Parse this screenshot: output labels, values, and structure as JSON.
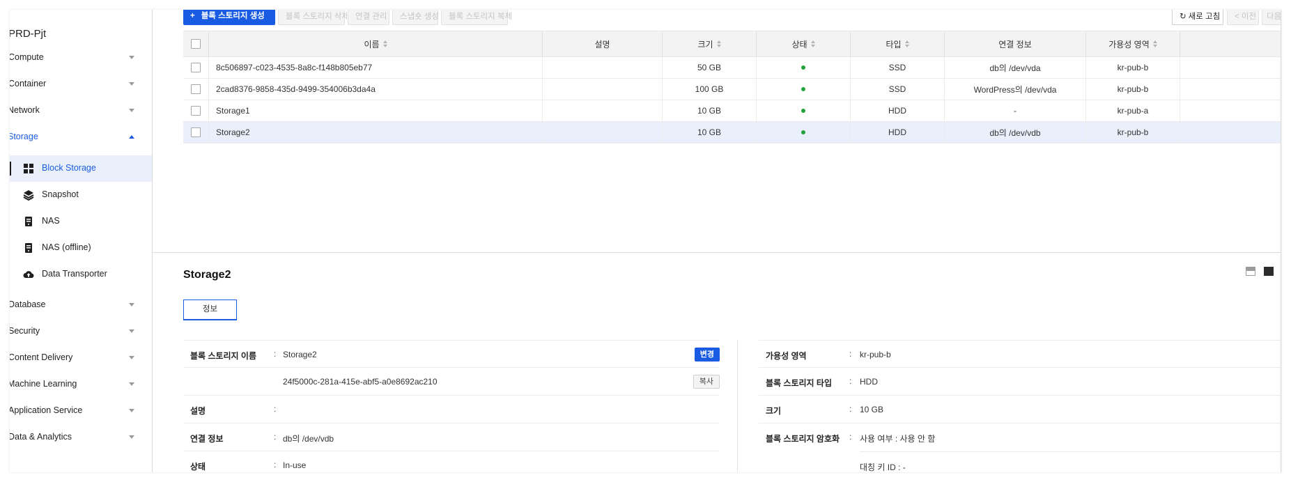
{
  "sidebar": {
    "project": "PRD-Pjt",
    "menus": [
      {
        "label": "Compute"
      },
      {
        "label": "Container"
      },
      {
        "label": "Network"
      },
      {
        "label": "Storage"
      },
      {
        "label": "Database"
      },
      {
        "label": "Security"
      },
      {
        "label": "Content Delivery"
      },
      {
        "label": "Machine Learning"
      },
      {
        "label": "Application Service"
      },
      {
        "label": "Data & Analytics"
      }
    ],
    "storage_items": [
      {
        "label": "Block Storage",
        "icon": "grid-icon"
      },
      {
        "label": "Snapshot",
        "icon": "layers-icon"
      },
      {
        "label": "NAS",
        "icon": "server-icon"
      },
      {
        "label": "NAS (offline)",
        "icon": "server-icon"
      },
      {
        "label": "Data Transporter",
        "icon": "cloud-upload-icon"
      }
    ]
  },
  "toolbar": {
    "create": "블록 스토리지 생성",
    "delete": "블록 스토리지 삭제",
    "connect": "연결 관리",
    "snapshot": "스냅숏 생성",
    "clone": "블록 스토리지 복제",
    "refresh": "새로 고침",
    "prev": "< 이전",
    "next": "다음"
  },
  "table": {
    "columns": [
      "이름",
      "설명",
      "크기",
      "상태",
      "타입",
      "연결 정보",
      "가용성 영역"
    ],
    "rows": [
      {
        "name": "8c506897-c023-4535-8a8c-f148b805eb77",
        "desc": "",
        "size": "50 GB",
        "type": "SSD",
        "conn": "db의 /dev/vda",
        "zone": "kr-pub-b"
      },
      {
        "name": "2cad8376-9858-435d-9499-354006b3da4a",
        "desc": "",
        "size": "100 GB",
        "type": "SSD",
        "conn": "WordPress의 /dev/vda",
        "zone": "kr-pub-b"
      },
      {
        "name": "Storage1",
        "desc": "",
        "size": "10 GB",
        "type": "HDD",
        "conn": "-",
        "zone": "kr-pub-a"
      },
      {
        "name": "Storage2",
        "desc": "",
        "size": "10 GB",
        "type": "HDD",
        "conn": "db의 /dev/vdb",
        "zone": "kr-pub-b"
      }
    ]
  },
  "detail": {
    "title": "Storage2",
    "tab": "정보",
    "left": {
      "name_label": "블록 스토리지 이름",
      "name_value": "Storage2",
      "change_btn": "변경",
      "id_value": "24f5000c-281a-415e-abf5-a0e8692ac210",
      "copy_btn": "복사",
      "desc_label": "설명",
      "conn_label": "연결 정보",
      "conn_value": "db의 /dev/vdb",
      "status_label": "상태",
      "status_value": "In-use"
    },
    "right": {
      "zone_label": "가용성 영역",
      "zone_value": "kr-pub-b",
      "type_label": "블록 스토리지 타입",
      "type_value": "HDD",
      "size_label": "크기",
      "size_value": "10 GB",
      "enc_label": "블록 스토리지 암호화",
      "enc_value": "사용 여부 : 사용 안 함",
      "key_value": "대칭 키 ID : -"
    }
  },
  "colors": {
    "accent": "#1a5be3",
    "status_ok": "#22a33b",
    "selected_row": "#e9f0fc"
  }
}
